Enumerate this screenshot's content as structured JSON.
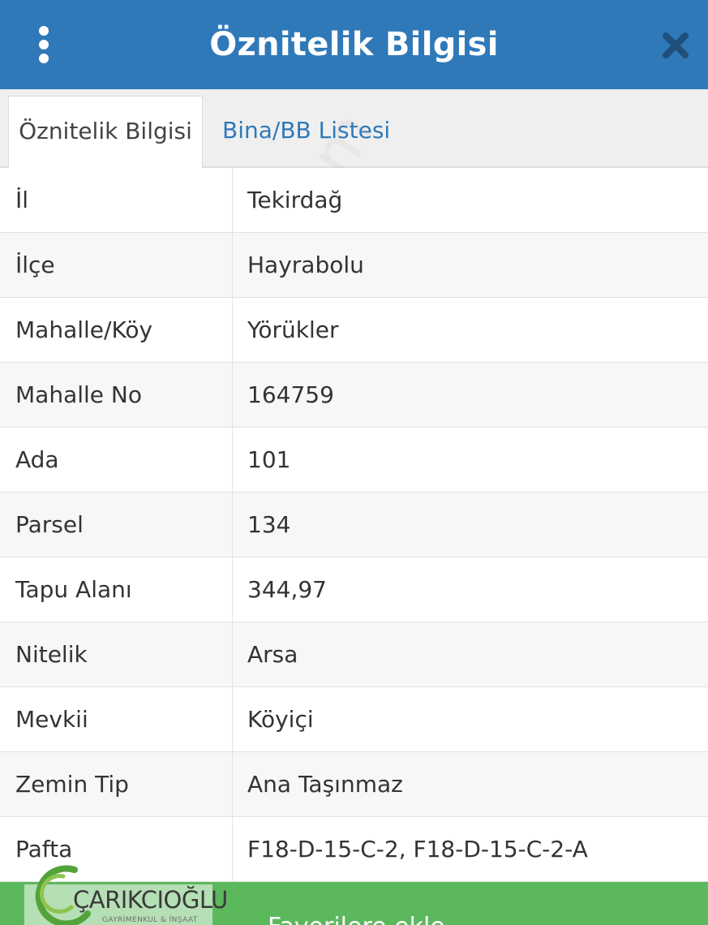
{
  "header": {
    "title": "Öznitelik Bilgisi",
    "menu_icon": "more-vertical-icon",
    "close_icon": "close-icon",
    "background_color": "#2f79b9"
  },
  "tabs": [
    {
      "label": "Öznitelik Bilgisi",
      "active": true
    },
    {
      "label": "Bina/BB Listesi",
      "active": false
    }
  ],
  "attributes": [
    {
      "label": "İl",
      "value": "Tekirdağ"
    },
    {
      "label": "İlçe",
      "value": "Hayrabolu"
    },
    {
      "label": "Mahalle/Köy",
      "value": "Yörükler"
    },
    {
      "label": "Mahalle No",
      "value": "164759"
    },
    {
      "label": "Ada",
      "value": "101"
    },
    {
      "label": "Parsel",
      "value": "134"
    },
    {
      "label": "Tapu Alanı",
      "value": "344,97"
    },
    {
      "label": "Nitelik",
      "value": "Arsa"
    },
    {
      "label": "Mevkii",
      "value": "Köyiçi"
    },
    {
      "label": "Zemin Tip",
      "value": "Ana Taşınmaz"
    },
    {
      "label": "Pafta",
      "value": "F18-D-15-C-2, F18-D-15-C-2-A"
    }
  ],
  "bottom_button": {
    "label": "Favorilere ekle",
    "color": "#5cb85c"
  },
  "logo": {
    "name": "ÇARIKCIOĞLU",
    "subtitle": "GAYRİMENKUL & İNŞAAT"
  },
  "watermark": {
    "text": "emlakjet.com"
  }
}
